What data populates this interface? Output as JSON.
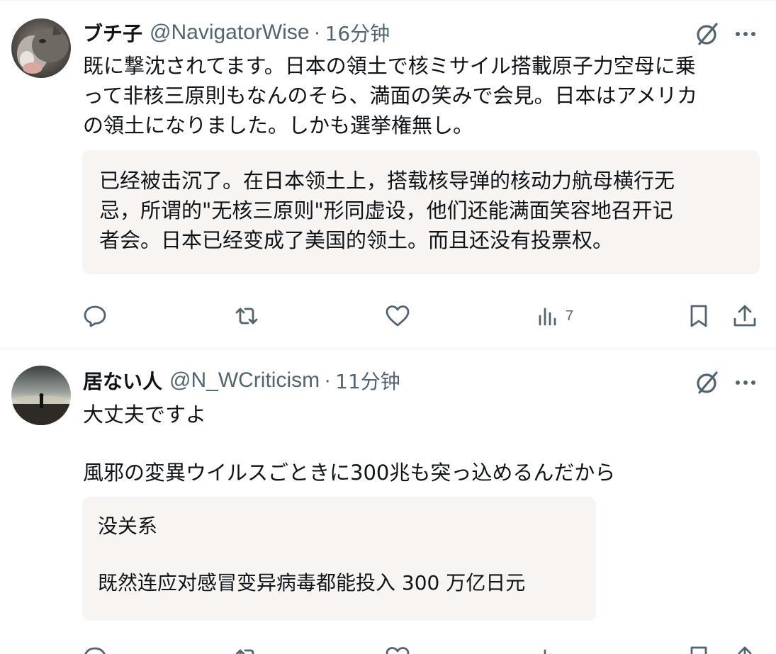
{
  "posts": [
    {
      "display_name": "ブチ子",
      "handle": "@NavigatorWise",
      "separator": "·",
      "time": "16分钟",
      "text_lines": [
        "既に撃沈されてます。日本の領土で核ミサイル搭載原子力空母に乗",
        "って非核三原則もなんのそら、満面の笑みで会見。日本はアメリカ",
        "の領土になりました。しかも選挙権無し。"
      ],
      "translation_lines": [
        "已经被击沉了。在日本领土上，搭载核导弹的核动力航母横行无",
        "忌，所谓的\"无核三原则\"形同虚设，他们还能满面笑容地召开记",
        "者会。日本已经变成了美国的领土。而且还没有投票权。"
      ],
      "views_count": "7",
      "icons": [
        "avatar",
        "grok-icon",
        "more-icon",
        "reply-icon",
        "repost-icon",
        "like-icon",
        "views-icon",
        "bookmark-icon",
        "share-icon"
      ]
    },
    {
      "display_name": "居ない人",
      "handle": "@N_WCriticism",
      "separator": "·",
      "time": "11分钟",
      "text_lines": [
        "大丈夫ですよ",
        "風邪の変異ウイルスごときに300兆も突っ込めるんだから"
      ],
      "translation_lines": [
        "没关系",
        "既然连应对感冒变异病毒都能投入 300 万亿日元"
      ],
      "icons": [
        "avatar",
        "grok-icon",
        "more-icon"
      ]
    }
  ],
  "colors": {
    "text": "#0f1419",
    "secondary": "#536471",
    "translation_bg": "#f7f4f2",
    "divider": "#eff3f4"
  }
}
